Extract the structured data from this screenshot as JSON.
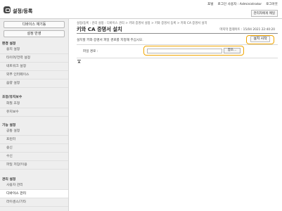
{
  "header": {
    "app_title": "설정/등록",
    "links": [
      "포털",
      "로그인 사용자 : Administrator",
      "로그아웃"
    ],
    "admin_mail": "관리자에게 메일"
  },
  "sidebar": {
    "device_status_button": "디바이스 재기동",
    "apply_settings_button": "설정 반영",
    "sections": [
      {
        "title": "환경 설정",
        "items": [
          "용지 설정",
          "타이머/전력 설정",
          "네트워크 설정",
          "외부 인터페이스",
          "음량 설정"
        ]
      },
      {
        "title": "조정/유지보수",
        "items": [
          "화질 조정",
          "유지보수"
        ]
      },
      {
        "title": "기능 설정",
        "items": [
          "공통 설정",
          "프린터",
          "송신",
          "수신",
          "파일 저장/이용"
        ]
      },
      {
        "title": "관리 설정",
        "items": [
          "사용자 관리",
          "디바이스 관리",
          "라이센스/기타"
        ]
      }
    ],
    "active_item": "디바이스 관리"
  },
  "main": {
    "breadcrumb": "설정/등록 : 관리 설정 : 디바이스 관리 > 키와 증명서 설정 > 키와 증명서 등록 > 키와 CA 증명서 설치",
    "title": "키와 CA 증명서 설치",
    "last_updated": "마지막 업데이트 : 15/04 2021 22:40:20",
    "install_button": "설치 시작",
    "description": "설치할 키와 증명서 파일 경로를 지정해 주십시오.",
    "file_path_label": "파일 경로 :",
    "file_path_value": "",
    "browse_button": "참조..."
  },
  "icons": {
    "logo": "settings-register-icon",
    "top": "scroll-to-top-icon"
  }
}
